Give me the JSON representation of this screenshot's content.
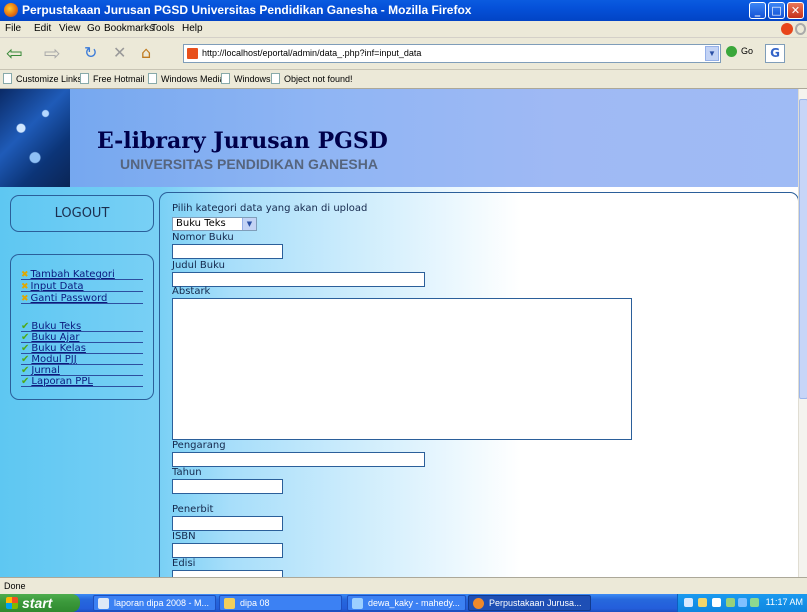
{
  "window": {
    "title": "Perpustakaan Jurusan PGSD Universitas Pendidikan Ganesha - Mozilla Firefox",
    "controls": {
      "minimize": "_",
      "maximize": "□",
      "close": "✕"
    }
  },
  "menubar": {
    "items": [
      "File",
      "Edit",
      "View",
      "Go",
      "Bookmarks",
      "Tools",
      "Help"
    ]
  },
  "navbar": {
    "back": "⇦",
    "forward": "⇨",
    "reload": "↻",
    "stop": "✕",
    "home": "⌂",
    "url": "http://localhost/eportal/admin/data_.php?inf=input_data",
    "go_label": "Go",
    "search_glyph": "G"
  },
  "bookmarks": {
    "items": [
      "Customize Links",
      "Free Hotmail",
      "Windows Media",
      "Windows",
      "Object not found!"
    ]
  },
  "page": {
    "title": "E-library Jurusan PGSD",
    "subtitle": "UNIVERSITAS PENDIDIKAN GANESHA",
    "logout": "LOGOUT",
    "admin_links": [
      "Tambah Kategori",
      "Input Data",
      "Ganti Password"
    ],
    "category_links": [
      "Buku Teks",
      "Buku Ajar",
      "Buku Kelas",
      "Modul PJJ",
      "Jurnal",
      "Laporan PPL"
    ],
    "form": {
      "intro": "Pilih kategori data yang akan di upload",
      "category_value": "Buku Teks",
      "fields": {
        "nomor": "Nomor Buku",
        "judul": "Judul Buku",
        "abstrak": "Abstark",
        "pengarang": "Pengarang",
        "tahun": "Tahun",
        "penerbit": "Penerbit",
        "isbn": "ISBN",
        "edisi": "Edisi"
      }
    }
  },
  "statusbar": {
    "text": "Done"
  },
  "taskbar": {
    "start": "start",
    "tasks": [
      "laporan dipa 2008 - M...",
      "dipa 08",
      "dewa_kaky - mahedy...",
      "Perpustakaan Jurusa..."
    ],
    "clock": "11:17 AM"
  },
  "colors": {
    "titlebar": "#0550d8",
    "sidebar": "#5ec7f2",
    "header": "#8fb5f4",
    "title_text": "#00004a"
  }
}
